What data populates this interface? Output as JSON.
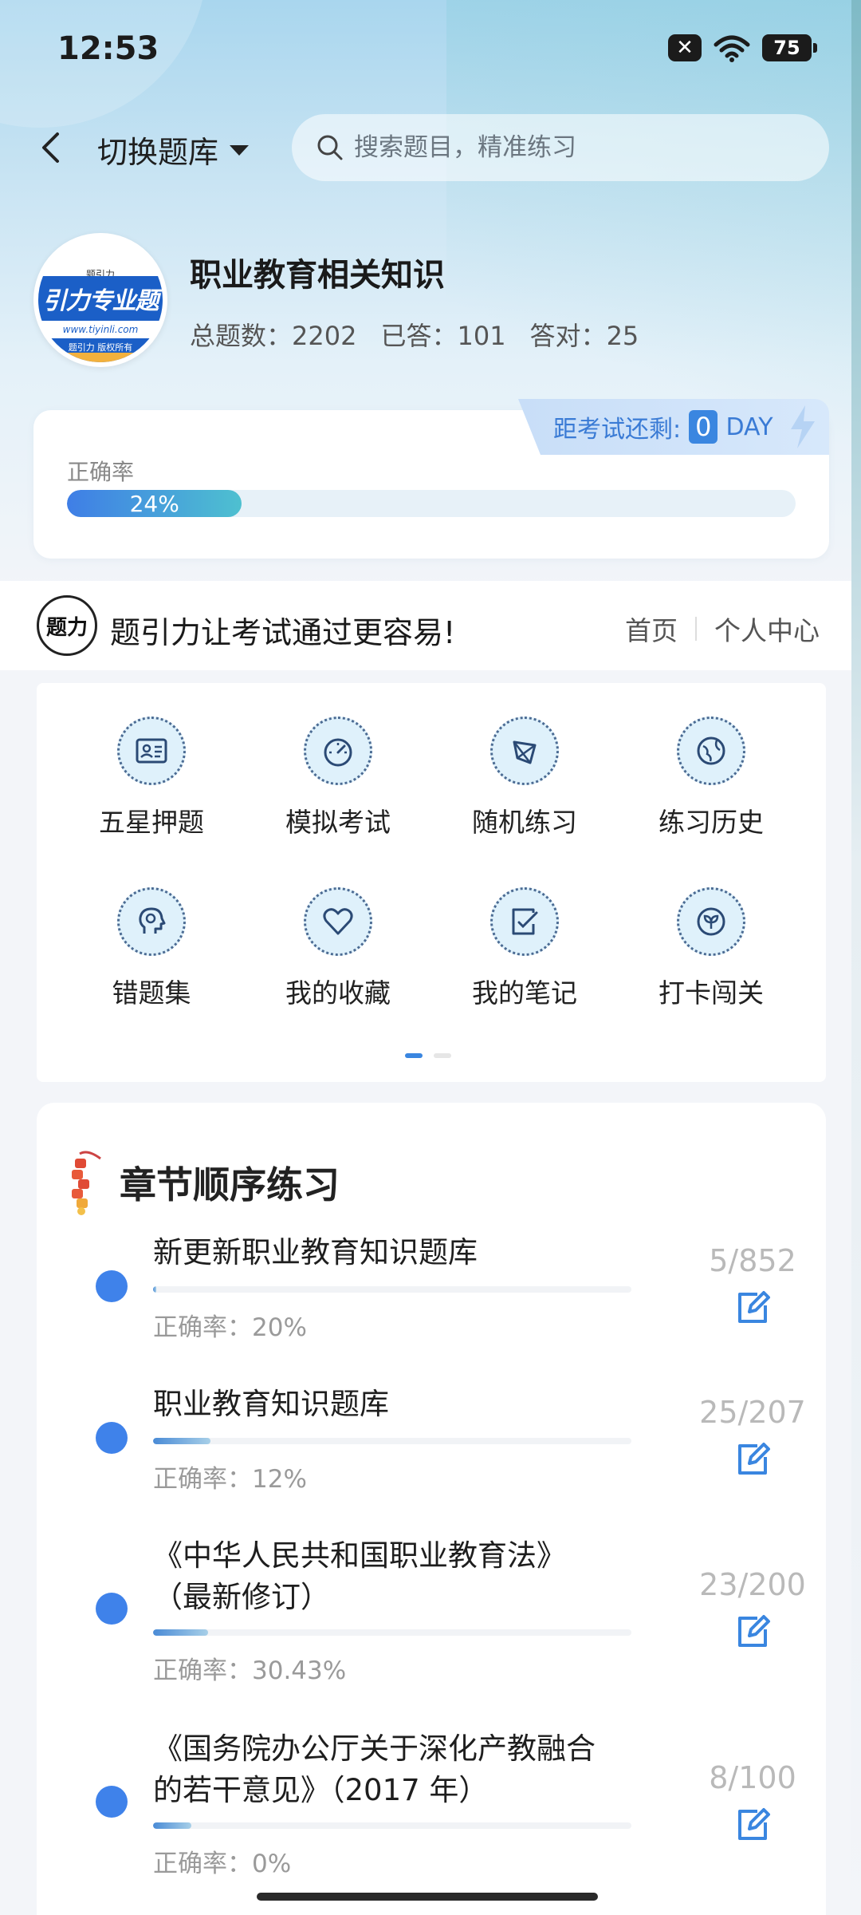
{
  "status_bar": {
    "time": "12:53",
    "battery": "75",
    "notif_icon": "x-badge-icon",
    "wifi_icon": "wifi-icon"
  },
  "nav": {
    "switch_label": "切换题库",
    "search_placeholder": "搜索题目，精准练习"
  },
  "bank": {
    "logo_top": "题引力",
    "logo_main": "引力专业题",
    "logo_url": "www.tiyinli.com",
    "logo_bottom": "题引力 版权所有",
    "title": "职业教育相关知识",
    "stats": {
      "total_label": "总题数：",
      "total": "2202",
      "answered_label": "已答：",
      "answered": "101",
      "correct_label": "答对：",
      "correct": "25"
    }
  },
  "accuracy": {
    "countdown_label": "距考试还剩:",
    "countdown_value": "0",
    "countdown_unit": "DAY",
    "label": "正确率",
    "percent_text": "24%",
    "percent": 24
  },
  "banner": {
    "logo_text": "题力",
    "text": "题引力让考试通过更容易!",
    "nav": [
      "首页",
      "个人中心"
    ]
  },
  "features": [
    {
      "label": "五星押题",
      "icon": "id-card-icon"
    },
    {
      "label": "模拟考试",
      "icon": "gauge-icon"
    },
    {
      "label": "随机练习",
      "icon": "shuffle-icon"
    },
    {
      "label": "练习历史",
      "icon": "globe-icon"
    },
    {
      "label": "错题集",
      "icon": "head-icon"
    },
    {
      "label": "我的收藏",
      "icon": "heart-icon"
    },
    {
      "label": "我的笔记",
      "icon": "note-icon"
    },
    {
      "label": "打卡闯关",
      "icon": "sprout-icon"
    }
  ],
  "pager": {
    "pages": 2,
    "active": 0
  },
  "chapters": {
    "title": "章节顺序练习",
    "items": [
      {
        "name": "新更新职业教育知识题库",
        "rate": "正确率：20%",
        "count": "5/852",
        "progress": 0.006
      },
      {
        "name": "职业教育知识题库",
        "rate": "正确率：12%",
        "count": "25/207",
        "progress": 0.12
      },
      {
        "name_line1": "《中华人民共和国职业教育法》",
        "name_line2": "（最新修订）",
        "rate": "正确率：30.43%",
        "count": "23/200",
        "progress": 0.115
      },
      {
        "name_line1": "《国务院办公厅关于深化产教融合",
        "name_line2": "的若干意见》（2017 年）",
        "rate": "正确率：0%",
        "count": "8/100",
        "progress": 0.08
      }
    ]
  },
  "colors": {
    "accent": "#3a86e0",
    "dot": "#3f82ea",
    "muted": "#9a9a9a"
  }
}
